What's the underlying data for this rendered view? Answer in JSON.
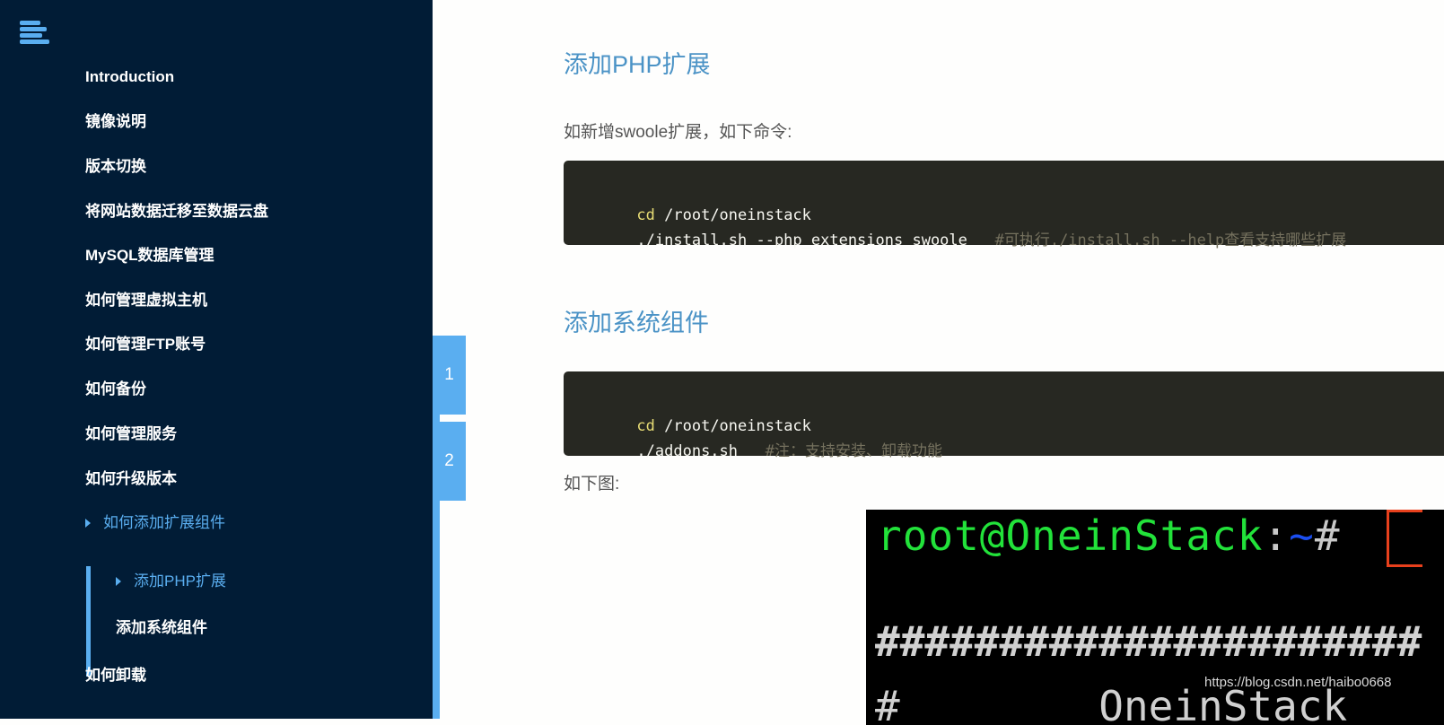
{
  "sidebar": {
    "menu_icon": "hamburger-menu-icon",
    "items": [
      {
        "label": "Introduction"
      },
      {
        "label": "镜像说明"
      },
      {
        "label": "版本切换"
      },
      {
        "label": "将网站数据迁移至数据云盘"
      },
      {
        "label": "MySQL数据库管理"
      },
      {
        "label": "如何管理虚拟主机"
      },
      {
        "label": "如何管理FTP账号"
      },
      {
        "label": "如何备份"
      },
      {
        "label": "如何管理服务"
      },
      {
        "label": "如何升级版本"
      },
      {
        "label": "如何添加扩展组件",
        "active": true
      },
      {
        "label": "如何卸载"
      }
    ],
    "subitems": [
      {
        "label": "添加PHP扩展",
        "active": true
      },
      {
        "label": "添加系统组件"
      }
    ]
  },
  "page_tabs": [
    {
      "label": "1"
    },
    {
      "label": "2"
    }
  ],
  "content": {
    "section1": {
      "heading": "添加PHP扩展",
      "intro": "如新增swoole扩展，如下命令:",
      "code": {
        "line1_kw": "cd",
        "line1_rest": " /root/oneinstack",
        "line2_cmd": "./install.sh --php_extensions swoole   ",
        "line2_comment": "#可执行./install.sh --help查看支持哪些扩展"
      }
    },
    "section2": {
      "heading": "添加系统组件",
      "code": {
        "line1_kw": "cd",
        "line1_rest": " /root/oneinstack",
        "line2_cmd": "./addons.sh   ",
        "line2_comment": "#注：支持安装、卸载功能"
      },
      "caption": "如下图:"
    },
    "screenshot": {
      "prompt_user": "root@OneinStack",
      "prompt_colon": ":",
      "prompt_tilde": "~",
      "prompt_hash": "#",
      "hash_line": "######################",
      "line3": "#        OneinStack",
      "watermark": "https://blog.csdn.net/haibo0668"
    }
  }
}
